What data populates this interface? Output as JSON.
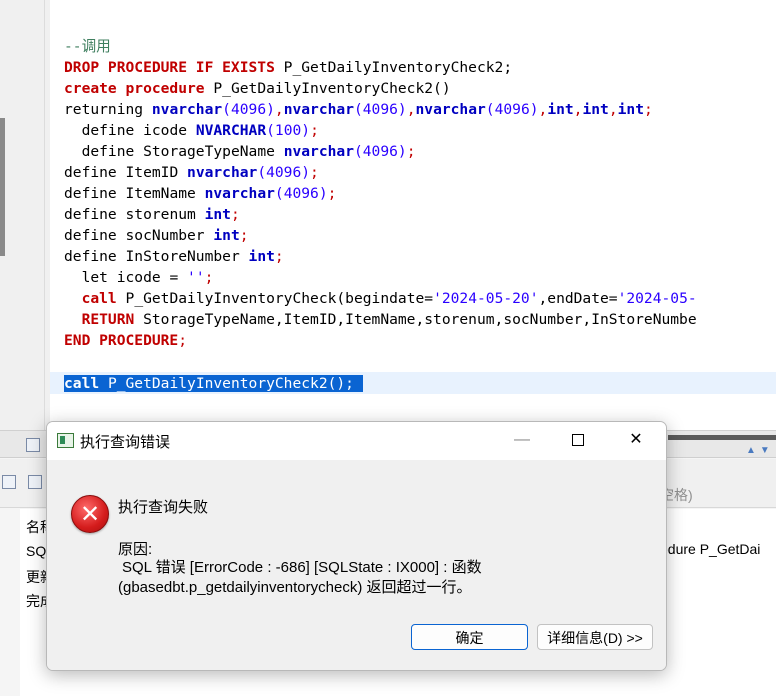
{
  "editor": {
    "comment": "--调用",
    "drop": {
      "kw": "DROP PROCEDURE IF EXISTS",
      "name": "P_GetDailyInventoryCheck2;"
    },
    "create": {
      "kw": "create procedure",
      "name": "P_GetDailyInventoryCheck2()"
    },
    "returning": {
      "kw": "returning",
      "t1": "nvarchar",
      "n1": "(4096)",
      "t2": "nvarchar",
      "n2": "(4096)",
      "t3": "nvarchar",
      "n3": "(4096)",
      "t4": "int",
      "t5": "int",
      "t6": "int"
    },
    "d1": {
      "kw": "define",
      "name": "icode",
      "type": "NVARCHAR",
      "size": "(100)"
    },
    "d2": {
      "kw": "define",
      "name": "StorageTypeName",
      "type": "nvarchar",
      "size": "(4096)"
    },
    "d3": {
      "kw": "define",
      "name": "ItemID",
      "type": "nvarchar",
      "size": "(4096)"
    },
    "d4": {
      "kw": "define",
      "name": "ItemName",
      "type": "nvarchar",
      "size": "(4096)"
    },
    "d5": {
      "kw": "define",
      "name": "storenum",
      "type": "int"
    },
    "d6": {
      "kw": "define",
      "name": "socNumber",
      "type": "int"
    },
    "d7": {
      "kw": "define",
      "name": "InStoreNumber",
      "type": "int"
    },
    "let": {
      "kw": "let",
      "expr": "icode =",
      "str": "''"
    },
    "call1": {
      "kw": "call",
      "name": "P_GetDailyInventoryCheck(begindate=",
      "d1": "'2024-05-20'",
      "mid": ",endDate=",
      "d2": "'2024-05-"
    },
    "ret": {
      "kw": "RETURN",
      "cols": "StorageTypeName,ItemID,ItemName,storenum,socNumber,InStoreNumbe"
    },
    "end": {
      "kw": "END PROCEDURE"
    },
    "call2": {
      "kw": "call",
      "text": "P_GetDailyInventoryCheck2();"
    }
  },
  "bottom": {
    "rows": [
      "名称",
      "SQL",
      "更新",
      "完成"
    ],
    "filter_placeholder": "空格)",
    "right_cell": "edure P_GetDai"
  },
  "dialog": {
    "title": "执行查询错误",
    "minimize": "—",
    "close": "✕",
    "error_icon": "✕",
    "heading": "执行查询失败",
    "reason_label": "原因:",
    "detail_line1": "SQL 错误 [ErrorCode : -686]  [SQLState : IX000] : 函数",
    "detail_line2": "(gbasedbt.p_getdailyinventorycheck) 返回超过一行。",
    "ok_label": "确定",
    "detail_button": "详细信息(D) >>"
  }
}
